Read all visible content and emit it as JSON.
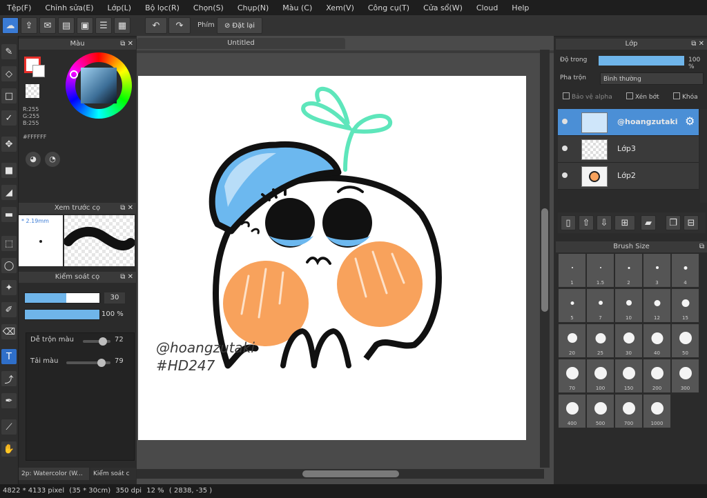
{
  "menu": [
    "Tệp(F)",
    "Chỉnh sửa(E)",
    "Lớp(L)",
    "Bộ lọc(R)",
    "Chọn(S)",
    "Chụp(N)",
    "Màu (C)",
    "Xem(V)",
    "Công cụ(T)",
    "Cửa sổ(W)",
    "Cloud",
    "Help"
  ],
  "toolbar": {
    "phim_label": "Phím",
    "reset_label": "Đặt lại"
  },
  "color_panel": {
    "title": "Màu",
    "rgb": [
      "R:255",
      "G:255",
      "B:255"
    ],
    "hex": "#FFFFFF",
    "accent": "#e8302b"
  },
  "brush_preview": {
    "title": "Xem trước cọ",
    "size": "* 2.19mm"
  },
  "brush_control": {
    "title": "Kiểm soát cọ",
    "size_value": "30",
    "opacity_value": "100 %",
    "blend_label": "Dễ trộn màu",
    "blend_value": "72",
    "load_label": "Tải màu",
    "load_value": "79",
    "size_fill": 0.56,
    "opacity_fill": 1.0,
    "blend_fill": 0.72,
    "load_fill": 0.79
  },
  "bottom_tabs": [
    "2p: Watercolor (W...",
    "Kiểm soát c"
  ],
  "document": {
    "tab_title": "Untitled"
  },
  "artwork": {
    "watermark_line1": "@hoangzutaki",
    "watermark_line2": "#HD247"
  },
  "layers_panel": {
    "title": "Lớp",
    "opacity_label": "Độ trong",
    "opacity_value": "100 %",
    "blend_label": "Pha trộn",
    "blend_value": "Bình thường",
    "opt_protect": "Bảo vệ alpha",
    "opt_clip": "Xén bớt",
    "opt_lock": "Khóa",
    "layers": [
      {
        "name": "@hoangzutaki",
        "selected": true
      },
      {
        "name": "Lớp3",
        "selected": false
      },
      {
        "name": "Lớp2",
        "selected": false
      }
    ]
  },
  "brush_size": {
    "title": "Brush Size",
    "rows": [
      [
        "1",
        "1.5",
        "2",
        "3",
        "4"
      ],
      [
        "5",
        "7",
        "10",
        "12",
        "15"
      ],
      [
        "20",
        "25",
        "30",
        "40",
        "50"
      ],
      [
        "70",
        "100",
        "150",
        "200",
        "300"
      ],
      [
        "400",
        "500",
        "700",
        "1000"
      ]
    ]
  },
  "status": {
    "pixels": "4822 * 4133 pixel",
    "cm": "(35 * 30cm)",
    "dpi": "350 dpi",
    "zoom": "12 %",
    "coords": "( 2838, -35 )"
  }
}
